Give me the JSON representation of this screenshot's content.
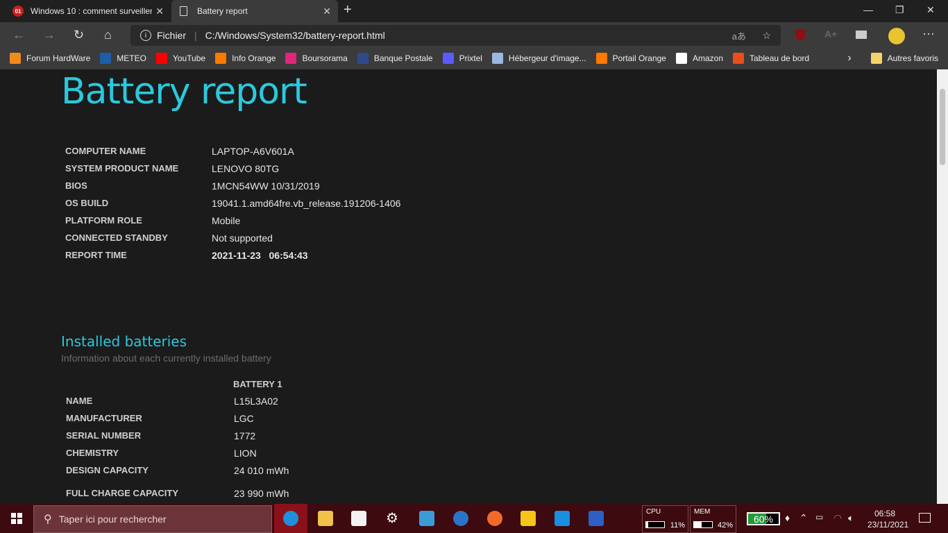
{
  "browser": {
    "tabs": [
      {
        "title": "Windows 10 : comment surveiller",
        "icon": "01net-icon"
      },
      {
        "title": "Battery report",
        "icon": "page-icon"
      }
    ],
    "address": {
      "label": "Fichier",
      "url": "C:/Windows/System32/battery-report.html"
    },
    "bookmarks": [
      {
        "label": "Forum HardWare",
        "color": "#f08a1c"
      },
      {
        "label": "METEO",
        "color": "#1d5ea8"
      },
      {
        "label": "YouTube",
        "color": "#ff0000"
      },
      {
        "label": "Info Orange",
        "color": "#ff7900"
      },
      {
        "label": "Boursorama",
        "color": "#e0257a"
      },
      {
        "label": "Banque Postale",
        "color": "#2e4a8c"
      },
      {
        "label": "Prixtel",
        "color": "#5b5bff"
      },
      {
        "label": "Hébergeur d'image...",
        "color": "#9ab8e0"
      },
      {
        "label": "Portail Orange",
        "color": "#ff7900"
      },
      {
        "label": "Amazon",
        "color": "#ffffff"
      },
      {
        "label": "Tableau de bord",
        "color": "#e94e1b"
      }
    ],
    "other_favorites": "Autres favoris"
  },
  "report": {
    "title": "Battery report",
    "system": [
      {
        "k": "COMPUTER NAME",
        "v": "LAPTOP-A6V601A"
      },
      {
        "k": "SYSTEM PRODUCT NAME",
        "v": "LENOVO 80TG"
      },
      {
        "k": "BIOS",
        "v": "1MCN54WW 10/31/2019"
      },
      {
        "k": "OS BUILD",
        "v": "19041.1.amd64fre.vb_release.191206-1406"
      },
      {
        "k": "PLATFORM ROLE",
        "v": "Mobile"
      },
      {
        "k": "CONNECTED STANDBY",
        "v": "Not supported"
      },
      {
        "k": "REPORT TIME",
        "v": "2021-11-23   06:54:43"
      }
    ],
    "installed": {
      "heading": "Installed batteries",
      "subtitle": "Information about each currently installed battery",
      "column": "BATTERY 1",
      "rows": [
        {
          "k": "NAME",
          "v": "L15L3A02"
        },
        {
          "k": "MANUFACTURER",
          "v": "LGC"
        },
        {
          "k": "SERIAL NUMBER",
          "v": "1772"
        },
        {
          "k": "CHEMISTRY",
          "v": "LION"
        },
        {
          "k": "DESIGN CAPACITY",
          "v": "24 010 mWh"
        },
        {
          "k": "FULL CHARGE CAPACITY",
          "v": "23 990 mWh"
        }
      ]
    }
  },
  "taskbar": {
    "search_placeholder": "Taper ici pour rechercher",
    "cpu": {
      "label": "CPU",
      "value": "11%",
      "fraction": 0.11
    },
    "mem": {
      "label": "MEM",
      "value": "42%",
      "fraction": 0.42
    },
    "battery": {
      "value": "60%",
      "fraction": 0.6
    },
    "time": "06:58",
    "date": "23/11/2021"
  }
}
